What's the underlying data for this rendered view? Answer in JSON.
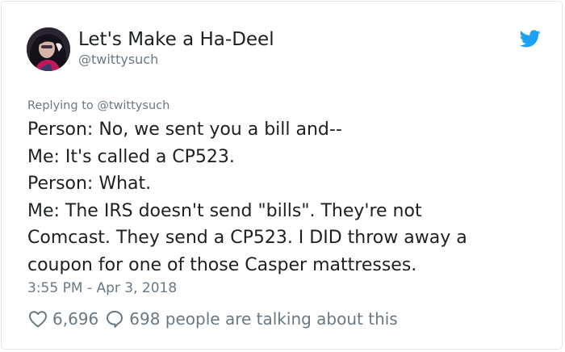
{
  "author": {
    "display_name": "Let's Make a Ha-Deel",
    "handle": "@twittysuch"
  },
  "reply_context": {
    "prefix": "Replying to",
    "mention": "@twittysuch"
  },
  "tweet": {
    "lines": [
      "Person: No, we sent you a bill and--",
      "Me: It's called a CP523.",
      "Person: What.",
      "Me: The IRS doesn't send \"bills\". They're not",
      "Comcast. They send a CP523. I DID throw away a",
      "coupon for one of those Casper mattresses."
    ],
    "timestamp": "3:55 PM - Apr 3, 2018"
  },
  "engagement": {
    "likes": "6,696",
    "talking": "698 people are talking about this"
  },
  "icons": {
    "brand": "twitter-bird-icon",
    "like": "heart-icon",
    "reply": "speech-bubble-icon"
  },
  "colors": {
    "twitter_blue": "#1da1f2",
    "secondary_text": "#697882",
    "primary_text": "#1c2022"
  }
}
